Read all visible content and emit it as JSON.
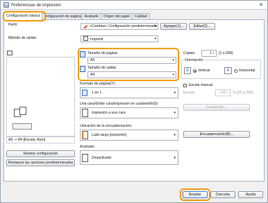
{
  "window": {
    "title": "Preferencias de impresión",
    "close": "✕"
  },
  "tabs": [
    "Configuración básica",
    "onfiguración de página",
    "Acabado",
    "Origen del papel",
    "Calidad"
  ],
  "profile": {
    "label": "Perfil:",
    "value": "<Cambiar> Configuración predeterminada",
    "add_label": "Agregar(1)...",
    "edit_label": "Editar(2)..."
  },
  "output": {
    "label": "Método de salida:",
    "value": "Imprimir"
  },
  "page_size": {
    "label": "Tamaño de página:",
    "value": "A5"
  },
  "output_size": {
    "label": "Tamaño de salida:",
    "value": "A4"
  },
  "copies": {
    "label": "Copias:",
    "value": "1",
    "range": "[1 a 999]"
  },
  "orientation": {
    "label": "Orientación",
    "vertical": "Vertical",
    "horizontal": "Horizontal",
    "selected": "Vertical"
  },
  "page_layout": {
    "label": "Formato de página(Y):",
    "value": "1 en 1"
  },
  "manual_scale": {
    "label": "Escala manual",
    "checked": false,
    "scale_label": "Escala:",
    "scale_value": "143",
    "scale_range": "% [25 a 200]"
  },
  "duplex": {
    "label": "Una cara/Doble cara/Impresión en cuadernillo(5):",
    "value": "Impresión a una cara",
    "booklet_button": "Cuadernillo..."
  },
  "binding": {
    "label": "Ubicación de la encuadernación:",
    "value": "Lado largo [izquierdo]",
    "button": "Encuadernación(B)..."
  },
  "finishing": {
    "label": "Acabado:",
    "value": "Desactivado"
  },
  "preview": {
    "caption": "A5 -> A4 [Escala: Auto]",
    "show_settings": "Mostrar configuración",
    "restore_defaults": "Restaurar las opciones predeterminadas"
  },
  "footer": {
    "ok": "Aceptar",
    "cancel": "Cancelar",
    "help": "Ayuda"
  },
  "colors": {
    "highlight": "#f39800",
    "accent": "#1f5fbf"
  }
}
